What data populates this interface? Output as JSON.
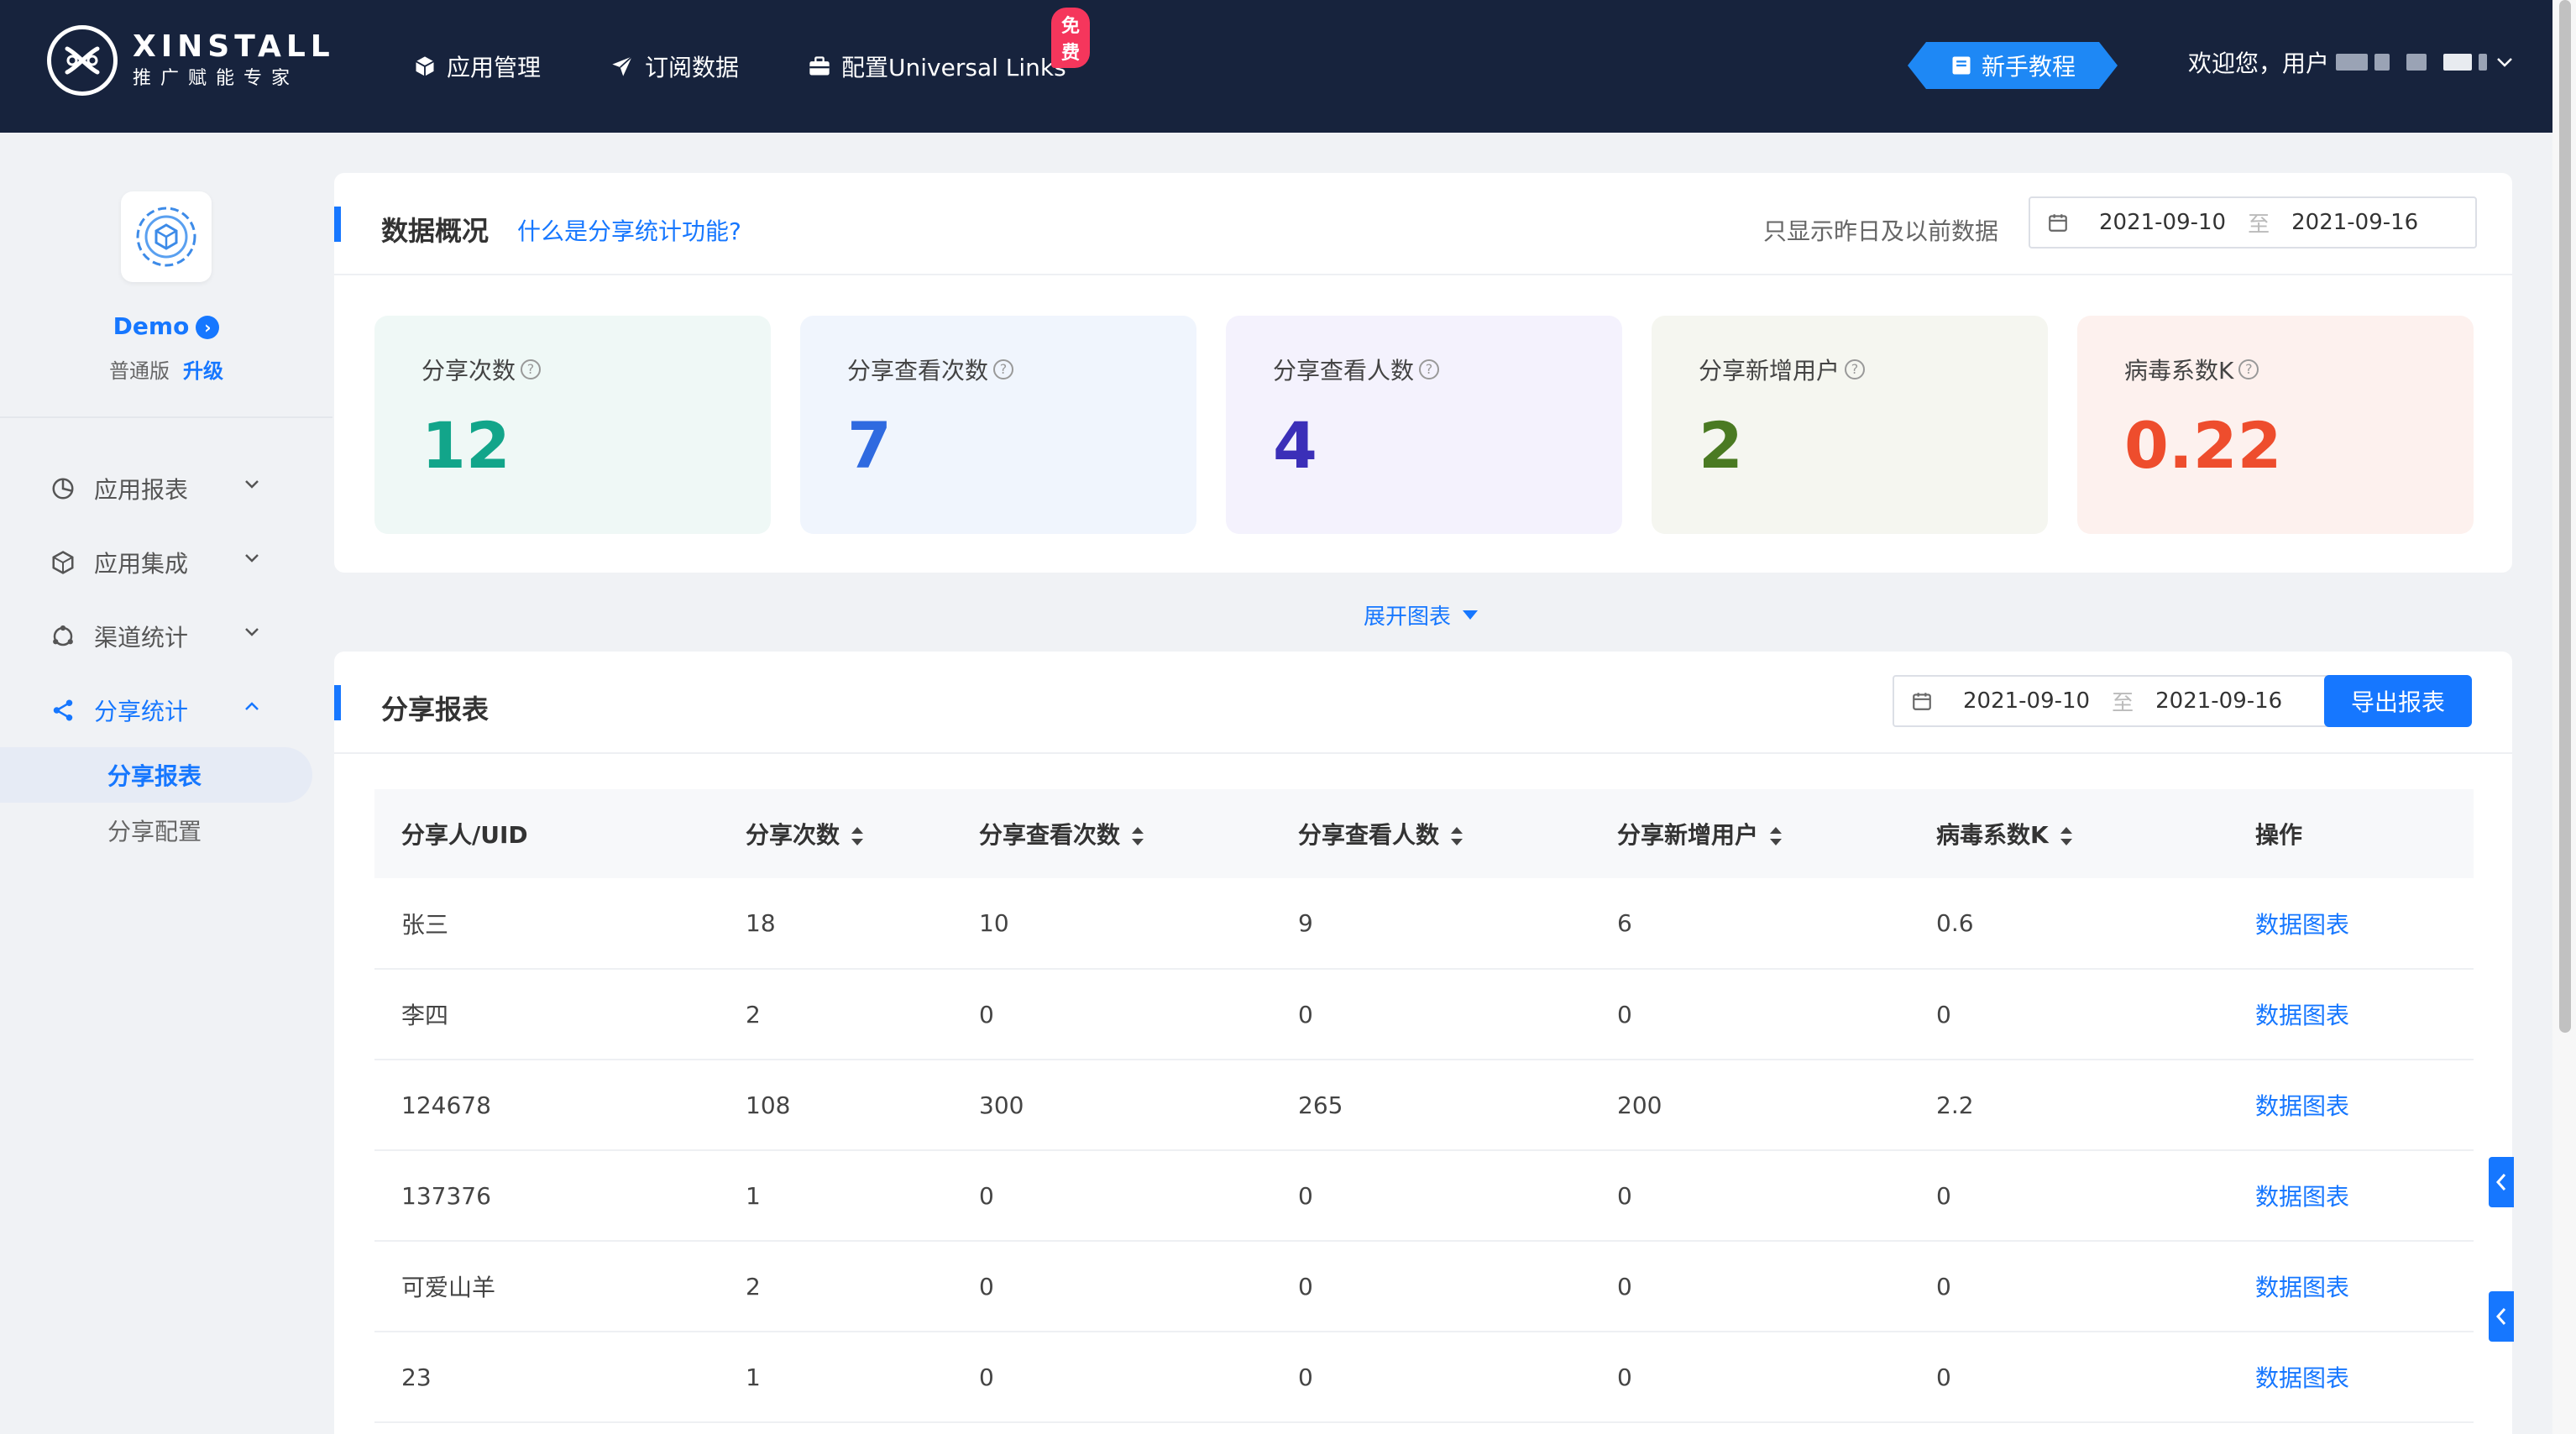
{
  "brand": {
    "name": "XINSTALL",
    "tagline": "推广赋能专家"
  },
  "nav": {
    "items": [
      {
        "label": "应用管理",
        "icon": "cube-icon"
      },
      {
        "label": "订阅数据",
        "icon": "paper-plane-icon"
      },
      {
        "label": "配置Universal Links",
        "icon": "briefcase-icon"
      }
    ],
    "free_badge": "免费",
    "tutorial": "新手教程",
    "greeting": "欢迎您，用户"
  },
  "app": {
    "name": "Demo",
    "plan": "普通版",
    "upgrade": "升级"
  },
  "sidebar": {
    "menu": [
      {
        "label": "应用报表",
        "icon": "pie-chart-icon"
      },
      {
        "label": "应用集成",
        "icon": "cube-outline-icon"
      },
      {
        "label": "渠道统计",
        "icon": "channel-icon"
      },
      {
        "label": "分享统计",
        "icon": "share-icon"
      }
    ],
    "sub": [
      {
        "label": "分享报表"
      },
      {
        "label": "分享配置"
      }
    ]
  },
  "overview": {
    "title": "数据概况",
    "help_link": "什么是分享统计功能?",
    "note": "只显示昨日及以前数据",
    "date_from": "2021-09-10",
    "date_sep": "至",
    "date_to": "2021-09-16",
    "metrics": [
      {
        "label": "分享次数",
        "value": "12",
        "color": "#12a58a",
        "bg": "#eff8f6"
      },
      {
        "label": "分享查看次数",
        "value": "7",
        "color": "#2f6ae0",
        "bg": "#f0f5fd"
      },
      {
        "label": "分享查看人数",
        "value": "4",
        "color": "#3b2fb8",
        "bg": "#f4f2fd"
      },
      {
        "label": "分享新增用户",
        "value": "2",
        "color": "#4a7a22",
        "bg": "#f5f6f0"
      },
      {
        "label": "病毒系数K",
        "value": "0.22",
        "color": "#ee4d2d",
        "bg": "#fdf1ee"
      }
    ],
    "expand": "展开图表"
  },
  "report": {
    "title": "分享报表",
    "date_from": "2021-09-10",
    "date_sep": "至",
    "date_to": "2021-09-16",
    "export": "导出报表",
    "columns": [
      "分享人/UID",
      "分享次数",
      "分享查看次数",
      "分享查看人数",
      "分享新增用户",
      "病毒系数K",
      "操作"
    ],
    "rows": [
      [
        "张三",
        "18",
        "10",
        "9",
        "6",
        "0.6",
        "数据图表"
      ],
      [
        "李四",
        "2",
        "0",
        "0",
        "0",
        "0",
        "数据图表"
      ],
      [
        "124678",
        "108",
        "300",
        "265",
        "200",
        "2.2",
        "数据图表"
      ],
      [
        "137376",
        "1",
        "0",
        "0",
        "0",
        "0",
        "数据图表"
      ],
      [
        "可爱山羊",
        "2",
        "0",
        "0",
        "0",
        "0",
        "数据图表"
      ],
      [
        "23",
        "1",
        "0",
        "0",
        "0",
        "0",
        "数据图表"
      ]
    ]
  }
}
